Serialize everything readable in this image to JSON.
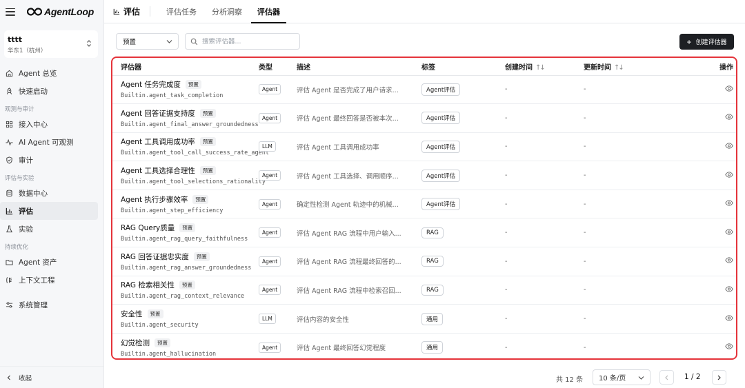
{
  "app": {
    "name": "AgentLoop"
  },
  "workspace": {
    "name": "tttt",
    "region": "华东1（杭州）"
  },
  "sidebar": {
    "top_items": [
      {
        "label": "Agent 总览",
        "icon": "home-icon"
      },
      {
        "label": "快速启动",
        "icon": "rocket-icon"
      }
    ],
    "group1": {
      "title": "观测与审计",
      "items": [
        {
          "label": "接入中心",
          "icon": "grid-icon"
        },
        {
          "label": "AI Agent 可观测",
          "icon": "pulse-icon"
        },
        {
          "label": "审计",
          "icon": "shield-icon"
        }
      ]
    },
    "group2": {
      "title": "评估与实验",
      "items": [
        {
          "label": "数据中心",
          "icon": "database-icon"
        },
        {
          "label": "评估",
          "icon": "bar-chart-icon"
        },
        {
          "label": "实验",
          "icon": "flask-icon"
        }
      ]
    },
    "group3": {
      "title": "持续优化",
      "items": [
        {
          "label": "Agent 资产",
          "icon": "folder-icon"
        },
        {
          "label": "上下文工程",
          "icon": "context-icon"
        }
      ]
    },
    "settings": {
      "label": "系统管理",
      "icon": "sliders-icon"
    },
    "collapse": {
      "label": "收起"
    }
  },
  "header": {
    "section": "评估",
    "tabs": [
      "评估任务",
      "分析洞察",
      "评估器"
    ]
  },
  "toolbar": {
    "filter_value": "预置",
    "search_placeholder": "搜索评估器...",
    "create_label": "创建评估器"
  },
  "table": {
    "columns": {
      "name": "评估器",
      "type": "类型",
      "desc": "描述",
      "tag": "标签",
      "created": "创建时间",
      "updated": "更新时间",
      "op": "操作"
    },
    "preset_badge": "预置",
    "rows": [
      {
        "name": "Agent 任务完成度",
        "id": "Builtin.agent_task_completion",
        "type": "Agent",
        "desc": "评估 Agent 是否完成了用户请求...",
        "tag": "Agent评估",
        "created": "-",
        "updated": "-"
      },
      {
        "name": "Agent 回答证据支持度",
        "id": "Builtin.agent_final_answer_groundedness",
        "type": "Agent",
        "desc": "评估 Agent 最终回答是否被本次...",
        "tag": "Agent评估",
        "created": "-",
        "updated": "-"
      },
      {
        "name": "Agent 工具调用成功率",
        "id": "Builtin.agent_tool_call_success_rate_agent",
        "type": "LLM",
        "desc": "评估 Agent 工具调用成功率",
        "tag": "Agent评估",
        "created": "-",
        "updated": "-"
      },
      {
        "name": "Agent 工具选择合理性",
        "id": "Builtin.agent_tool_selections_rationality",
        "type": "Agent",
        "desc": "评估 Agent 工具选择、调用顺序...",
        "tag": "Agent评估",
        "created": "-",
        "updated": "-"
      },
      {
        "name": "Agent 执行步骤效率",
        "id": "Builtin.agent_step_efficiency",
        "type": "Agent",
        "desc": "确定性检测 Agent 轨迹中的机械...",
        "tag": "Agent评估",
        "created": "-",
        "updated": "-"
      },
      {
        "name": "RAG Query质量",
        "id": "Builtin.agent_rag_query_faithfulness",
        "type": "Agent",
        "desc": "评估 Agent RAG 流程中用户输入...",
        "tag": "RAG",
        "created": "-",
        "updated": "-"
      },
      {
        "name": "RAG 回答证据忠实度",
        "id": "Builtin.agent_rag_answer_groundedness",
        "type": "Agent",
        "desc": "评估 Agent RAG 流程最终回答的...",
        "tag": "RAG",
        "created": "-",
        "updated": "-"
      },
      {
        "name": "RAG 检索相关性",
        "id": "Builtin.agent_rag_context_relevance",
        "type": "Agent",
        "desc": "评估 Agent RAG 流程中检索召回...",
        "tag": "RAG",
        "created": "-",
        "updated": "-"
      },
      {
        "name": "安全性",
        "id": "Builtin.agent_security",
        "type": "LLM",
        "desc": "评估内容的安全性",
        "tag": "通用",
        "created": "-",
        "updated": "-"
      },
      {
        "name": "幻觉检测",
        "id": "Builtin.agent_hallucination",
        "type": "Agent",
        "desc": "评估 Agent 最终回答幻觉程度",
        "tag": "通用",
        "created": "-",
        "updated": "-"
      }
    ]
  },
  "pagination": {
    "total": "共 12 条",
    "page_size": "10 条/页",
    "page": "1 / 2"
  }
}
